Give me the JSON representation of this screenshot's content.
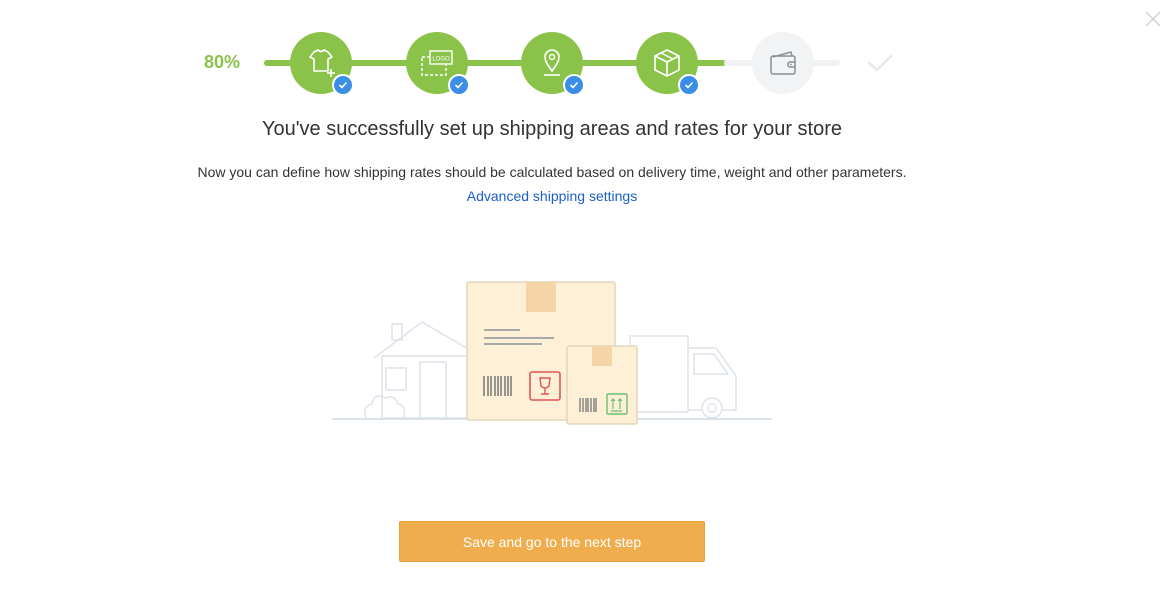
{
  "progress": {
    "percent_label": "80%",
    "value": 0.8
  },
  "steps": [
    {
      "name": "tshirt-add-icon",
      "status": "done"
    },
    {
      "name": "logo-icon",
      "status": "done"
    },
    {
      "name": "location-pin-icon",
      "status": "done"
    },
    {
      "name": "box-icon",
      "status": "done"
    },
    {
      "name": "wallet-icon",
      "status": "todo"
    },
    {
      "name": "finish-check-icon",
      "status": "todo"
    }
  ],
  "main": {
    "title": "You've successfully set up shipping areas and rates for your store",
    "description": "Now you can define how shipping rates should be calculated based on delivery time, weight and other parameters.",
    "link_label": "Advanced shipping settings",
    "primary_button": "Save and go to the next step"
  },
  "colors": {
    "accent_green": "#8bc34a",
    "check_blue": "#3a8ee6",
    "link_blue": "#1b5ec7",
    "button_orange": "#f0ad4e"
  },
  "icons": {
    "close": "close-icon"
  }
}
